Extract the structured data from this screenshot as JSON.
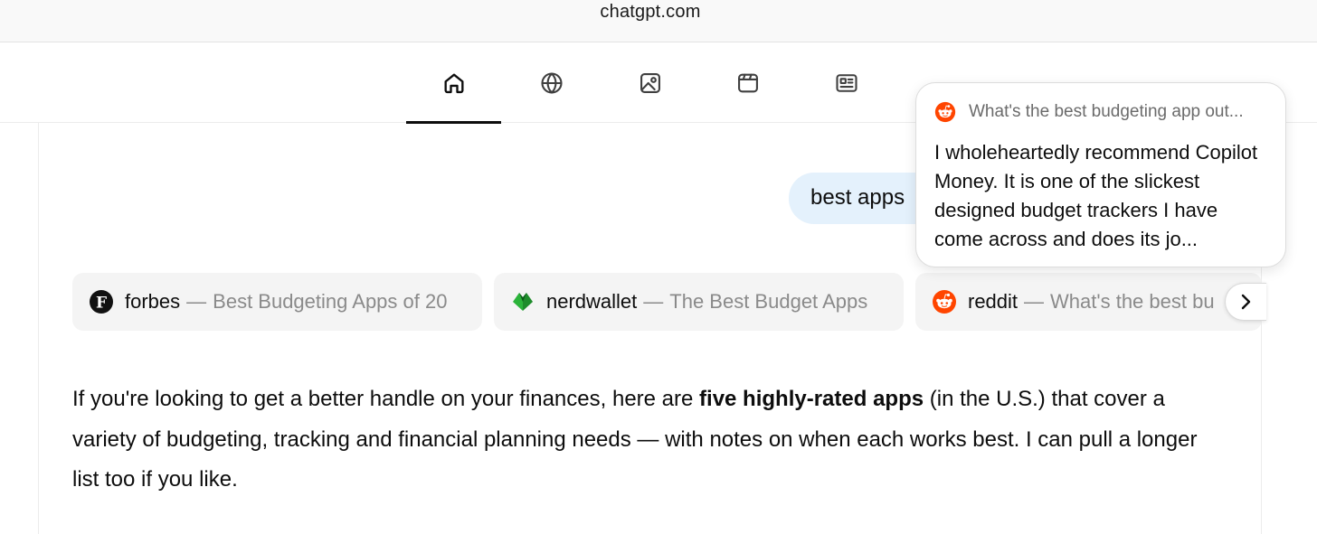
{
  "browser": {
    "url": "chatgpt.com"
  },
  "tabs": [
    {
      "name": "home",
      "icon": "home-icon",
      "active": true
    },
    {
      "name": "web",
      "icon": "globe-icon",
      "active": false
    },
    {
      "name": "images",
      "icon": "image-icon",
      "active": false
    },
    {
      "name": "videos",
      "icon": "video-icon",
      "active": false
    },
    {
      "name": "news",
      "icon": "news-icon",
      "active": false
    }
  ],
  "user_message": "best apps",
  "sources": [
    {
      "site": "forbes",
      "separator": "—",
      "title": "Best Budgeting Apps of 20",
      "icon": "forbes-logo-icon"
    },
    {
      "site": "nerdwallet",
      "separator": "—",
      "title": "The Best Budget Apps",
      "icon": "nerdwallet-logo-icon"
    },
    {
      "site": "reddit",
      "separator": "—",
      "title": "What's the best bu",
      "icon": "reddit-logo-icon"
    }
  ],
  "answer": {
    "part1": "If you're looking to get a better handle on your finances, here are ",
    "bold": "five highly-rated apps",
    "part2": " (in the U.S.) that cover a variety of budgeting, tracking and financial planning needs — with notes on when each works best. I can pull a longer list too if you like."
  },
  "popover": {
    "icon": "reddit-logo-icon",
    "title": "What's the best budgeting app out...",
    "snippet": "I wholeheartedly recommend Copilot Money. It is one of the slickest designed budget trackers I have come across and does its jo..."
  },
  "colors": {
    "user_bubble": "#e4f1fc",
    "chip_bg": "#f4f4f4",
    "reddit": "#ff4500",
    "nerdwallet": "#2bb33a"
  }
}
